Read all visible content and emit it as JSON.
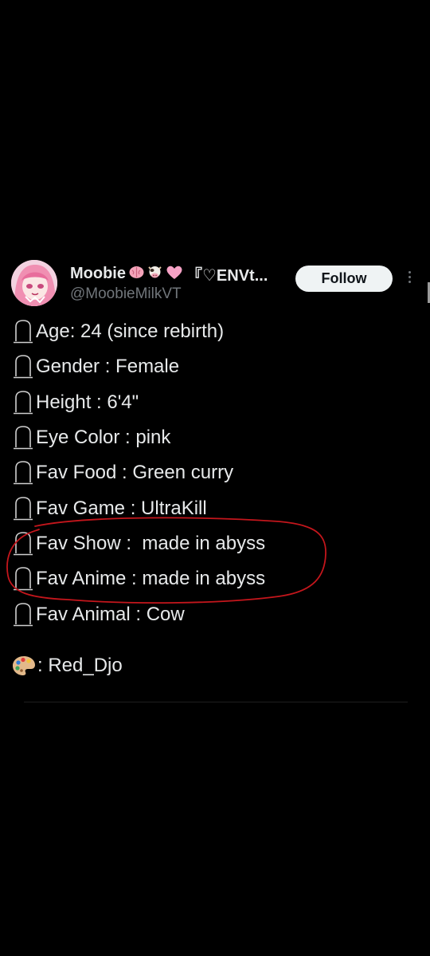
{
  "post": {
    "display_name": "Moobie",
    "display_name_suffix": "『♡ENVt...",
    "handle": "@MoobieMilkVT",
    "follow_label": "Follow",
    "name_emojis": [
      "brain-emoji",
      "cow-emoji",
      "pink-heart-emoji"
    ],
    "bio_lines": [
      "Age: 24 (since rebirth)",
      "Gender : Female",
      "Height : 6'4\"",
      "Eye Color : pink",
      "Fav Food : Green curry",
      "Fav Game : UltraKill",
      "Fav Show :  made in abyss",
      "Fav Anime : made in abyss",
      "Fav Animal : Cow"
    ],
    "credit": ": Red_Djo"
  },
  "colors": {
    "background": "#000000",
    "text": "#e7e9ea",
    "muted": "#71767b",
    "follow_bg": "#eff3f4",
    "annotation": "#c4161c"
  }
}
